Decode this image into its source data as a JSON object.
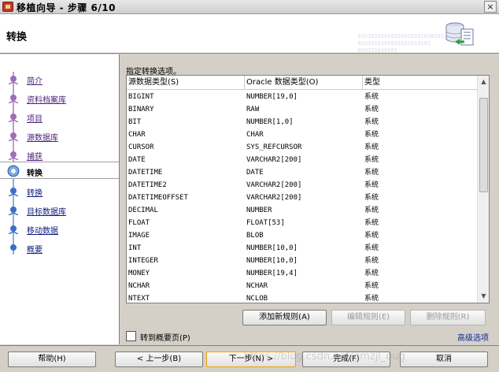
{
  "window": {
    "title": "移植向导 - 步骤 6/10",
    "close_glyph": "×"
  },
  "header": {
    "title": "转换",
    "binary_text": [
      "01010101010101010101010101",
      "0101010101010101010101",
      "010101010101"
    ]
  },
  "sidebar": {
    "steps": [
      {
        "label": "简介",
        "state": "done"
      },
      {
        "label": "资料档案库",
        "state": "done"
      },
      {
        "label": "项目",
        "state": "done"
      },
      {
        "label": "源数据库",
        "state": "done"
      },
      {
        "label": "捕获",
        "state": "done"
      },
      {
        "label": "转换",
        "state": "current"
      },
      {
        "label": "转换",
        "state": "future"
      },
      {
        "label": "目标数据库",
        "state": "future"
      },
      {
        "label": "移动数据",
        "state": "future"
      },
      {
        "label": "概要",
        "state": "future"
      }
    ]
  },
  "main": {
    "instruction": "指定转换选项。",
    "table": {
      "columns": [
        "源数据类型(S)",
        "Oracle 数据类型(O)",
        "类型"
      ],
      "rows": [
        [
          "BIGINT",
          "NUMBER[19,0]",
          "系统"
        ],
        [
          "BINARY",
          "RAW",
          "系统"
        ],
        [
          "BIT",
          "NUMBER[1,0]",
          "系统"
        ],
        [
          "CHAR",
          "CHAR",
          "系统"
        ],
        [
          "CURSOR",
          "SYS_REFCURSOR",
          "系统"
        ],
        [
          "DATE",
          "VARCHAR2[200]",
          "系统"
        ],
        [
          "DATETIME",
          "DATE",
          "系统"
        ],
        [
          "DATETIME2",
          "VARCHAR2[200]",
          "系统"
        ],
        [
          "DATETIMEOFFSET",
          "VARCHAR2[200]",
          "系统"
        ],
        [
          "DECIMAL",
          "NUMBER",
          "系统"
        ],
        [
          "FLOAT",
          "FLOAT[53]",
          "系统"
        ],
        [
          "IMAGE",
          "BLOB",
          "系统"
        ],
        [
          "INT",
          "NUMBER[10,0]",
          "系统"
        ],
        [
          "INTEGER",
          "NUMBER[10,0]",
          "系统"
        ],
        [
          "MONEY",
          "NUMBER[19,4]",
          "系统"
        ],
        [
          "NCHAR",
          "NCHAR",
          "系统"
        ],
        [
          "NTEXT",
          "NCLOB",
          "系统"
        ]
      ]
    },
    "add_rule": "添加新规则(A)",
    "edit_rule": "编辑规则(E)",
    "delete_rule": "删除规则(R)",
    "goto_summary": "转到概要页(P)",
    "advanced": "高级选项"
  },
  "footer": {
    "help": "帮助(H)",
    "back": "< 上一步(B)",
    "next": "下一步(N) >",
    "finish": "完成(F)",
    "cancel": "取消"
  },
  "watermark": "https://blog.csdn.net/gmzjl_oug",
  "colors": {
    "done_node": "#9b6fb5",
    "future_node": "#3d6fc4",
    "link_done": "#4b1f7a",
    "link_future": "#0a1a7a"
  }
}
